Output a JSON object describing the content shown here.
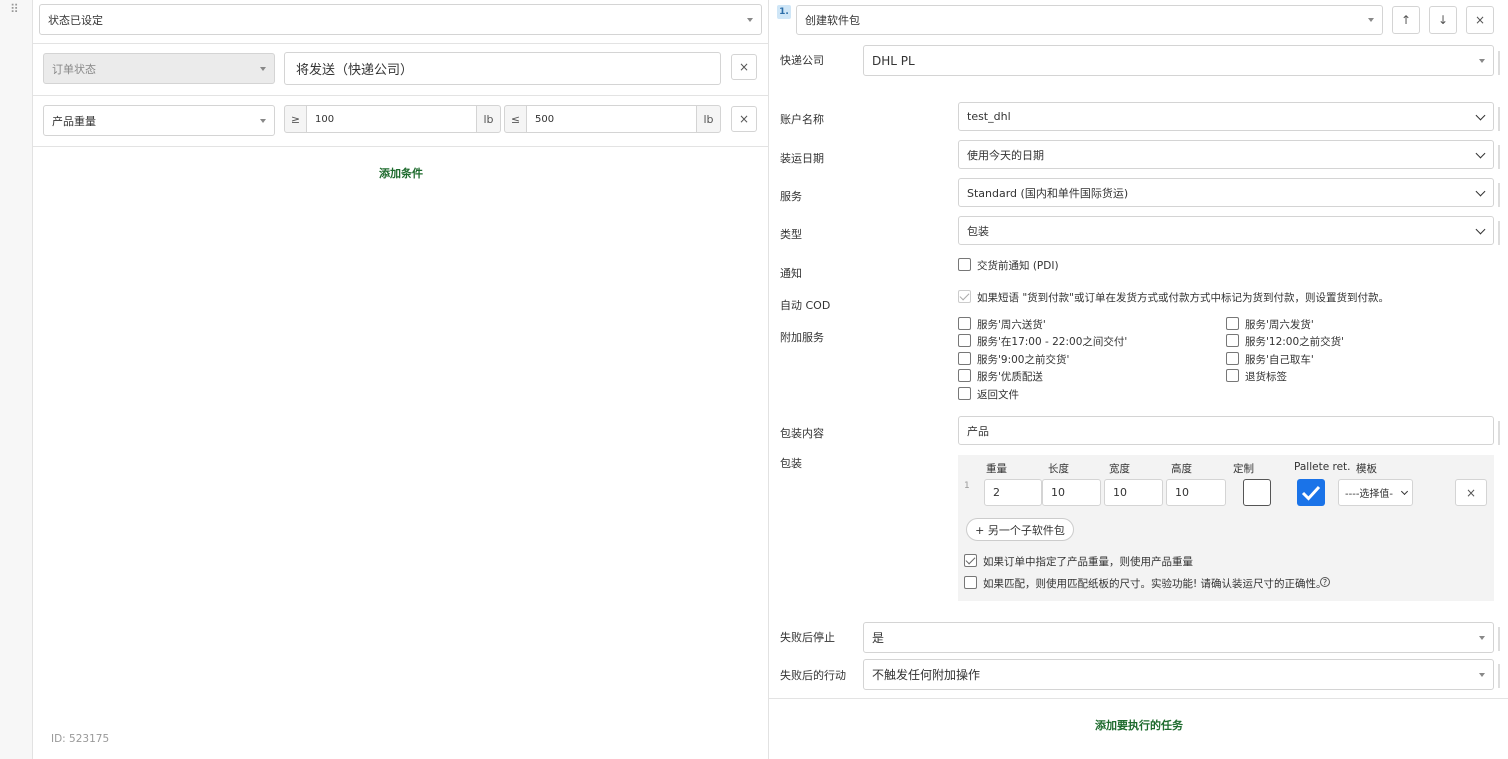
{
  "left": {
    "trigger_select": "状态已设定",
    "condition1": {
      "field": "订单状态",
      "value": "将发送（快递公司）",
      "remove": "×"
    },
    "condition2": {
      "field": "产品重量",
      "ge_symbol": "≥",
      "min": "100",
      "min_unit": "lb",
      "le_symbol": "≤",
      "max": "500",
      "max_unit": "lb",
      "remove": "×"
    },
    "add_condition": "添加条件",
    "id_text": "ID: 523175"
  },
  "right": {
    "step_number": "1.",
    "action_select": "创建软件包",
    "up_icon": "↑",
    "down_icon": "↓",
    "close_icon": "×",
    "courier_label": "快递公司",
    "courier_value": "DHL PL",
    "account_label": "账户名称",
    "account_value": "test_dhl",
    "ship_date_label": "装运日期",
    "ship_date_value": "使用今天的日期",
    "service_label": "服务",
    "service_value": "Standard (国内和单件国际货运)",
    "type_label": "类型",
    "type_value": "包装",
    "notify_label": "通知",
    "notify_option": "交货前通知 (PDI)",
    "cod_label": "自动 COD",
    "cod_text": "如果短语 \"货到付款\"或订单在发货方式或付款方式中标记为货到付款，则设置货到付款。",
    "extra_label": "附加服务",
    "extra_col1": [
      "服务'周六送货'",
      "服务'在17:00 - 22:00之间交付'",
      "服务'9:00之前交货'",
      "服务'优质配送",
      "返回文件"
    ],
    "extra_col2": [
      "服务'周六发货'",
      "服务'12:00之前交货'",
      "服务'自己取车'",
      "退货标签"
    ],
    "contents_label": "包装内容",
    "contents_value": "产品",
    "package_label": "包装",
    "pkg_headers": {
      "weight": "重量",
      "length": "长度",
      "width": "宽度",
      "height": "高度",
      "custom": "定制",
      "pallete": "Pallete ret.",
      "template": "模板"
    },
    "pkg_row": {
      "index": "1",
      "weight": "2",
      "length": "10",
      "width": "10",
      "height": "10",
      "template": "----选择值-",
      "remove": "×"
    },
    "add_subpackage": "+ 另一个子软件包",
    "use_product_weight": "如果订单中指定了产品重量，则使用产品重量",
    "use_carton_size": "如果匹配，则使用匹配纸板的尺寸。实验功能! 请确认装运尺寸的正确性。",
    "help_icon": "?",
    "stop_label": "失败后停止",
    "stop_value": "是",
    "after_fail_label": "失败后的行动",
    "after_fail_value": "不触发任何附加操作",
    "add_task": "添加要执行的任务"
  }
}
